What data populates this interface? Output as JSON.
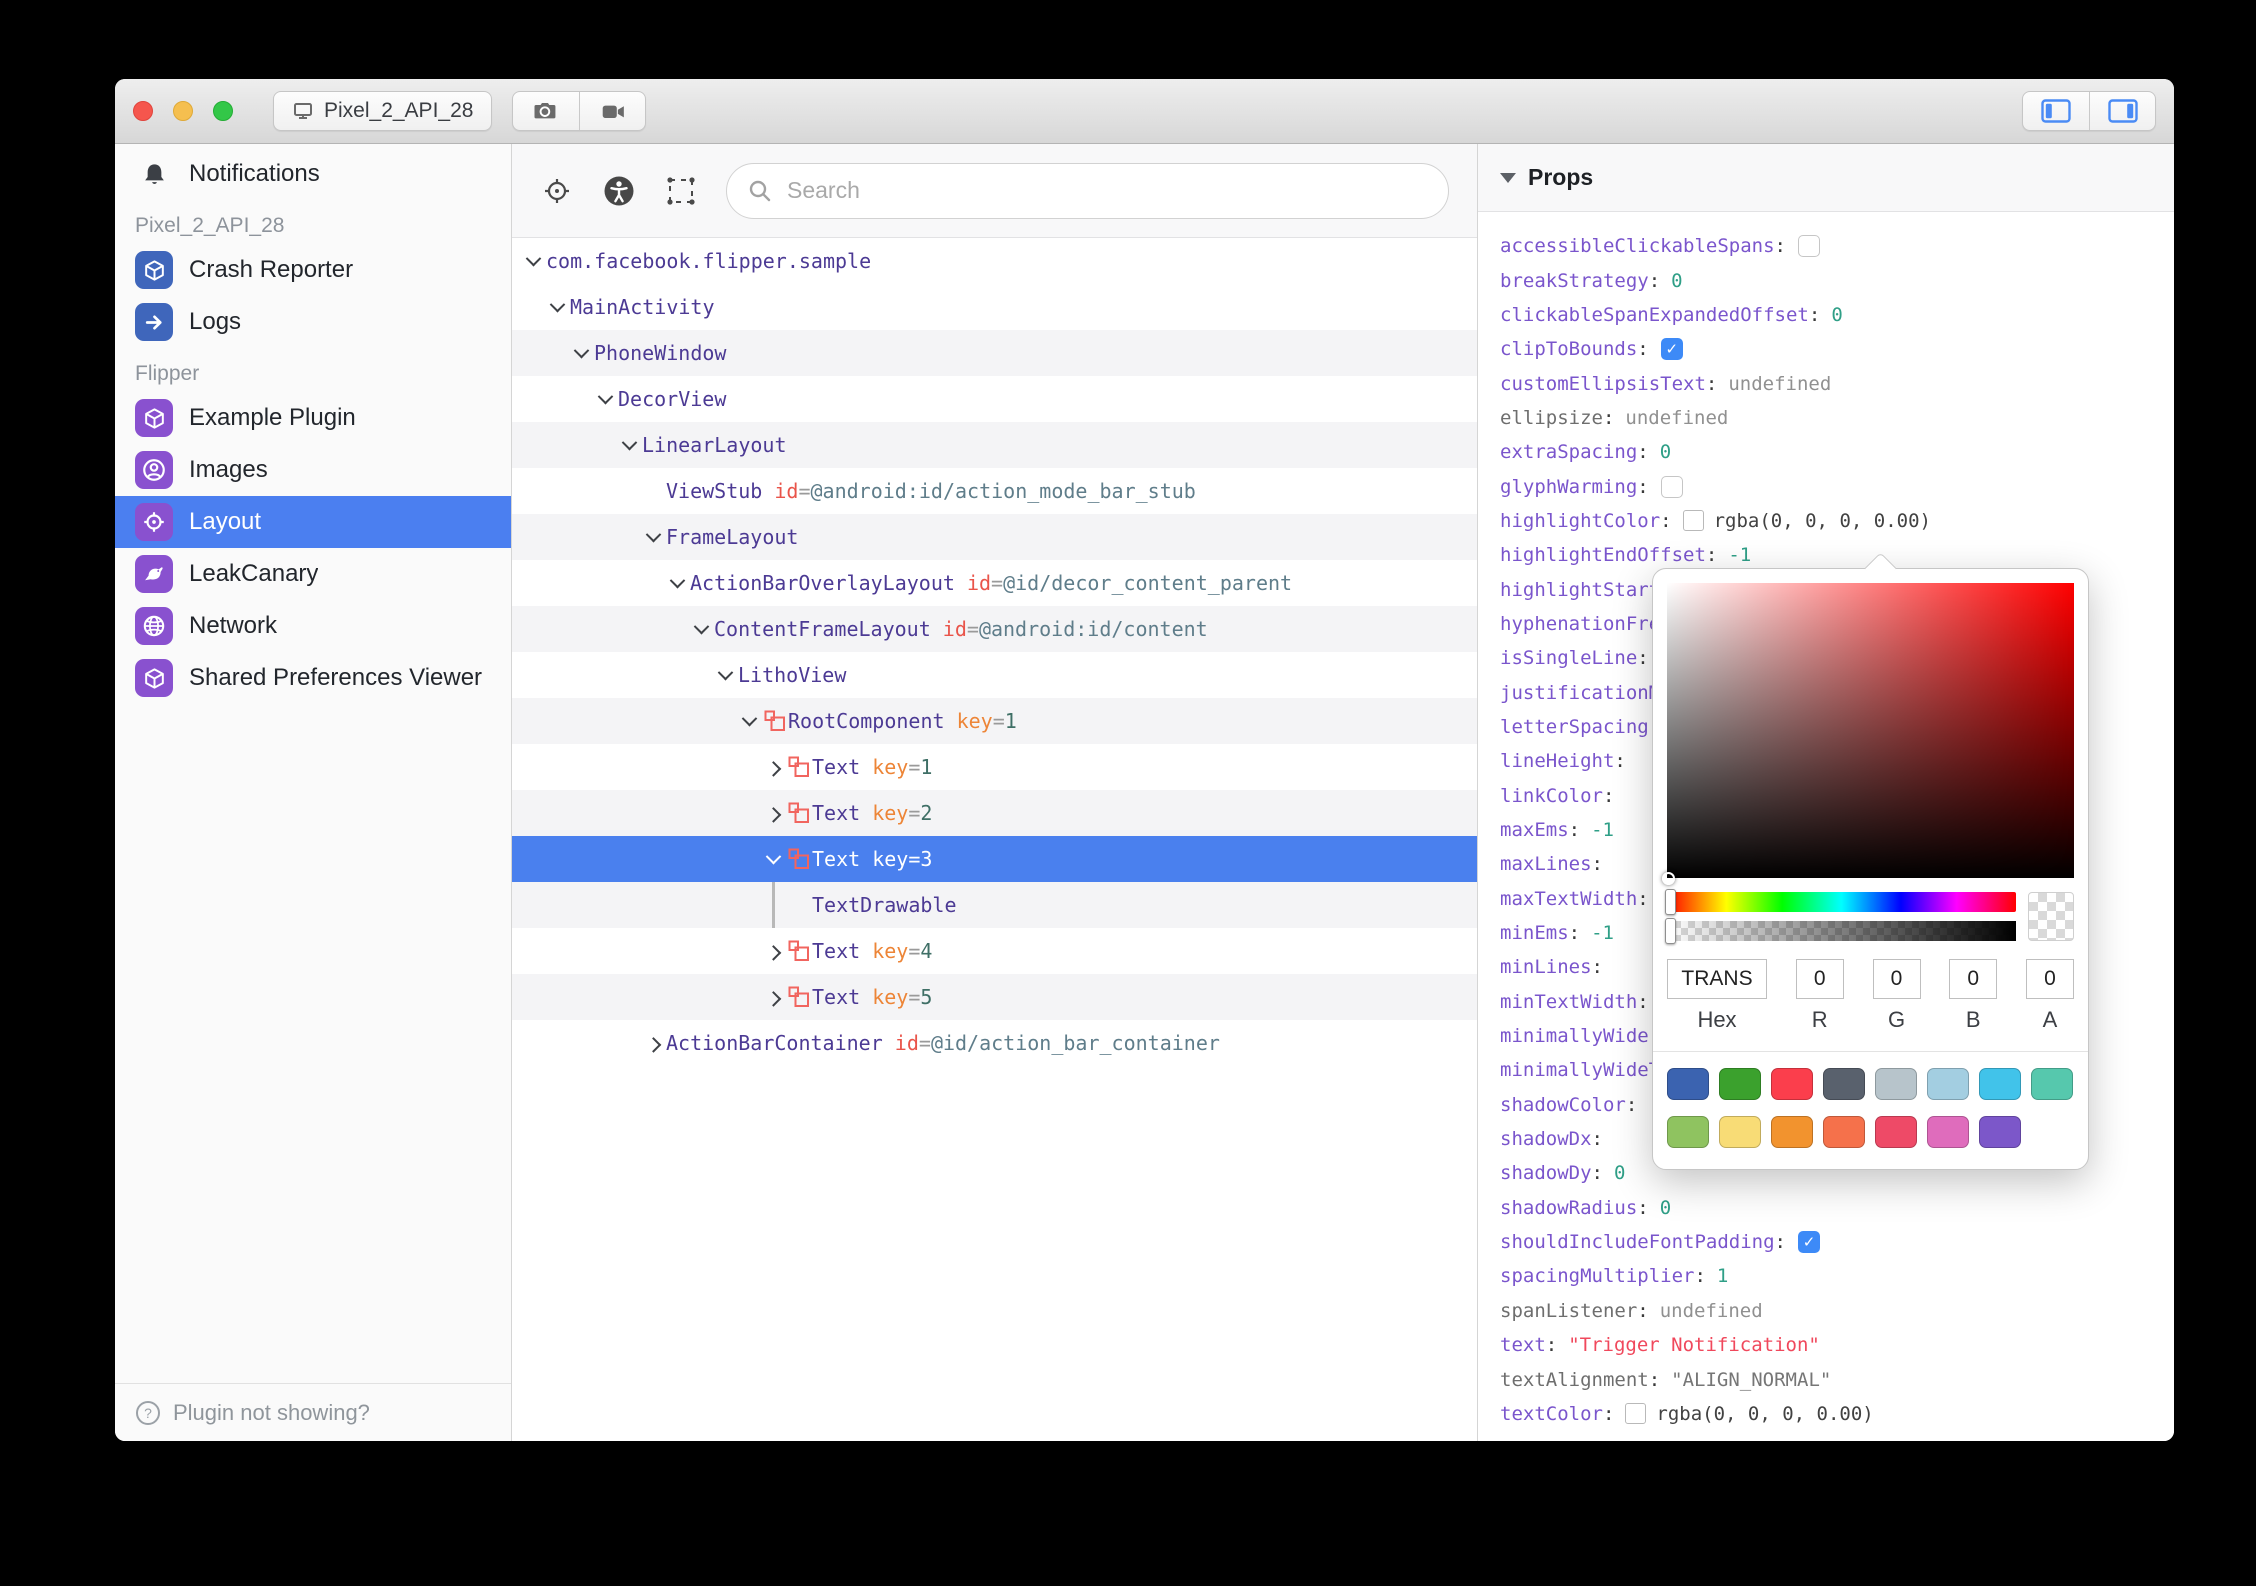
{
  "titlebar": {
    "device_label": "Pixel_2_API_28"
  },
  "sidebar": {
    "entries": [
      {
        "kind": "item",
        "label": "Notifications",
        "icon": "bell"
      },
      {
        "kind": "section",
        "label": "Pixel_2_API_28"
      },
      {
        "kind": "item",
        "label": "Crash Reporter",
        "icon": "cube",
        "color": "#3f66bb"
      },
      {
        "kind": "item",
        "label": "Logs",
        "icon": "arrow",
        "color": "#3f66bb"
      },
      {
        "kind": "section",
        "label": "Flipper"
      },
      {
        "kind": "item",
        "label": "Example Plugin",
        "icon": "cube",
        "color": "#8951cf"
      },
      {
        "kind": "item",
        "label": "Images",
        "icon": "user",
        "color": "#8951cf"
      },
      {
        "kind": "item",
        "label": "Layout",
        "icon": "target",
        "color": "#8951cf",
        "selected": true
      },
      {
        "kind": "item",
        "label": "LeakCanary",
        "icon": "bird",
        "color": "#8951cf"
      },
      {
        "kind": "item",
        "label": "Network",
        "icon": "globe",
        "color": "#8951cf"
      },
      {
        "kind": "item",
        "label": "Shared Preferences Viewer",
        "icon": "cube",
        "color": "#8951cf"
      }
    ],
    "footer_label": "Plugin not showing?"
  },
  "toolbar": {
    "search_placeholder": "Search"
  },
  "tree": {
    "rows": [
      {
        "level": 0,
        "chevron": "down",
        "name": "com.facebook.flipper.sample"
      },
      {
        "level": 1,
        "chevron": "down",
        "name": "MainActivity"
      },
      {
        "level": 2,
        "chevron": "down",
        "name": "PhoneWindow"
      },
      {
        "level": 3,
        "chevron": "down",
        "name": "DecorView"
      },
      {
        "level": 4,
        "chevron": "down",
        "name": "LinearLayout"
      },
      {
        "level": 5,
        "chevron": null,
        "name": "ViewStub",
        "attrs": [
          {
            "k": "id",
            "v": "@android:id/action_mode_bar_stub"
          }
        ]
      },
      {
        "level": 5,
        "chevron": "down",
        "name": "FrameLayout"
      },
      {
        "level": 6,
        "chevron": "down",
        "name": "ActionBarOverlayLayout",
        "attrs": [
          {
            "k": "id",
            "v": "@id/decor_content_parent"
          }
        ]
      },
      {
        "level": 7,
        "chevron": "down",
        "name": "ContentFrameLayout",
        "attrs": [
          {
            "k": "id",
            "v": "@android:id/content"
          }
        ]
      },
      {
        "level": 8,
        "chevron": "down",
        "name": "LithoView"
      },
      {
        "level": 9,
        "chevron": "down",
        "litho": true,
        "name": "RootComponent",
        "attrs": [
          {
            "k": "key",
            "v": "1"
          }
        ]
      },
      {
        "level": 10,
        "chevron": "right",
        "litho": true,
        "name": "Text",
        "attrs": [
          {
            "k": "key",
            "v": "1"
          }
        ]
      },
      {
        "level": 10,
        "chevron": "right",
        "litho": true,
        "name": "Text",
        "attrs": [
          {
            "k": "key",
            "v": "2"
          }
        ]
      },
      {
        "level": 10,
        "chevron": "down",
        "litho": true,
        "name": "Text",
        "attrs": [
          {
            "k": "key",
            "v": "3"
          }
        ],
        "selected": true
      },
      {
        "level": 10,
        "guide": true,
        "spacer": true,
        "name": "TextDrawable"
      },
      {
        "level": 10,
        "chevron": "right",
        "litho": true,
        "name": "Text",
        "attrs": [
          {
            "k": "key",
            "v": "4"
          }
        ]
      },
      {
        "level": 10,
        "chevron": "right",
        "litho": true,
        "name": "Text",
        "attrs": [
          {
            "k": "key",
            "v": "5"
          }
        ]
      },
      {
        "level": 5,
        "chevron": "right",
        "name": "ActionBarContainer",
        "attrs": [
          {
            "k": "id",
            "v": "@id/action_bar_container"
          }
        ]
      }
    ]
  },
  "props": {
    "header": "Props",
    "rows": [
      {
        "key": "accessibleClickableSpans",
        "type": "checkbox",
        "checked": false
      },
      {
        "key": "breakStrategy",
        "type": "number",
        "value": "0"
      },
      {
        "key": "clickableSpanExpandedOffset",
        "type": "number",
        "value": "0"
      },
      {
        "key": "clipToBounds",
        "type": "checkbox",
        "checked": true
      },
      {
        "key": "customEllipsisText",
        "type": "undefined",
        "value": "undefined"
      },
      {
        "key": "ellipsize",
        "type": "undefined",
        "value": "undefined",
        "muted": true
      },
      {
        "key": "extraSpacing",
        "type": "number",
        "value": "0"
      },
      {
        "key": "glyphWarming",
        "type": "checkbox",
        "checked": false
      },
      {
        "key": "highlightColor",
        "type": "color",
        "value": "rgba(0, 0, 0, 0.00)"
      },
      {
        "key": "highlightEndOffset",
        "type": "number",
        "value": "-1"
      },
      {
        "key": "highlightStartOffset",
        "type": "none"
      },
      {
        "key": "hyphenationFrequency",
        "type": "none"
      },
      {
        "key": "isSingleLine",
        "type": "none"
      },
      {
        "key": "justificationMode",
        "type": "none"
      },
      {
        "key": "letterSpacing",
        "type": "none"
      },
      {
        "key": "lineHeight",
        "type": "none"
      },
      {
        "key": "linkColor",
        "type": "none"
      },
      {
        "key": "maxEms",
        "type": "number",
        "value": "-1"
      },
      {
        "key": "maxLines",
        "type": "none"
      },
      {
        "key": "maxTextWidth",
        "type": "none"
      },
      {
        "key": "minEms",
        "type": "number",
        "value": "-1"
      },
      {
        "key": "minLines",
        "type": "none"
      },
      {
        "key": "minTextWidth",
        "type": "none"
      },
      {
        "key": "minimallyWide",
        "type": "none"
      },
      {
        "key": "minimallyWideThreshold",
        "type": "none"
      },
      {
        "key": "shadowColor",
        "type": "none"
      },
      {
        "key": "shadowDx",
        "type": "none"
      },
      {
        "key": "shadowDy",
        "type": "number",
        "value": "0"
      },
      {
        "key": "shadowRadius",
        "type": "number",
        "value": "0"
      },
      {
        "key": "shouldIncludeFontPadding",
        "type": "checkbox",
        "checked": true
      },
      {
        "key": "spacingMultiplier",
        "type": "number",
        "value": "1"
      },
      {
        "key": "spanListener",
        "type": "undefined",
        "value": "undefined",
        "muted": true
      },
      {
        "key": "text",
        "type": "string",
        "value": "\"Trigger Notification\""
      },
      {
        "key": "textAlignment",
        "type": "string-muted",
        "value": "\"ALIGN_NORMAL\"",
        "muted": true
      },
      {
        "key": "textColor",
        "type": "color",
        "value": "rgba(0, 0, 0, 0.00)"
      }
    ],
    "picker": {
      "hex": "TRANS",
      "r": "0",
      "g": "0",
      "b": "0",
      "a": "0",
      "labels": {
        "hex": "Hex",
        "r": "R",
        "g": "G",
        "b": "B",
        "a": "A"
      },
      "swatches_row1": [
        "#3b63b0",
        "#3ba12d",
        "#fb3e4c",
        "#59616d",
        "#b7c4cb",
        "#a3cee1",
        "#41c3ea",
        "#56c8ad"
      ],
      "swatches_row2": [
        "#8fc360",
        "#f8dc76",
        "#f2932e",
        "#f5714b",
        "#ee4a67",
        "#df6cbc",
        "#7c57c9"
      ]
    }
  }
}
